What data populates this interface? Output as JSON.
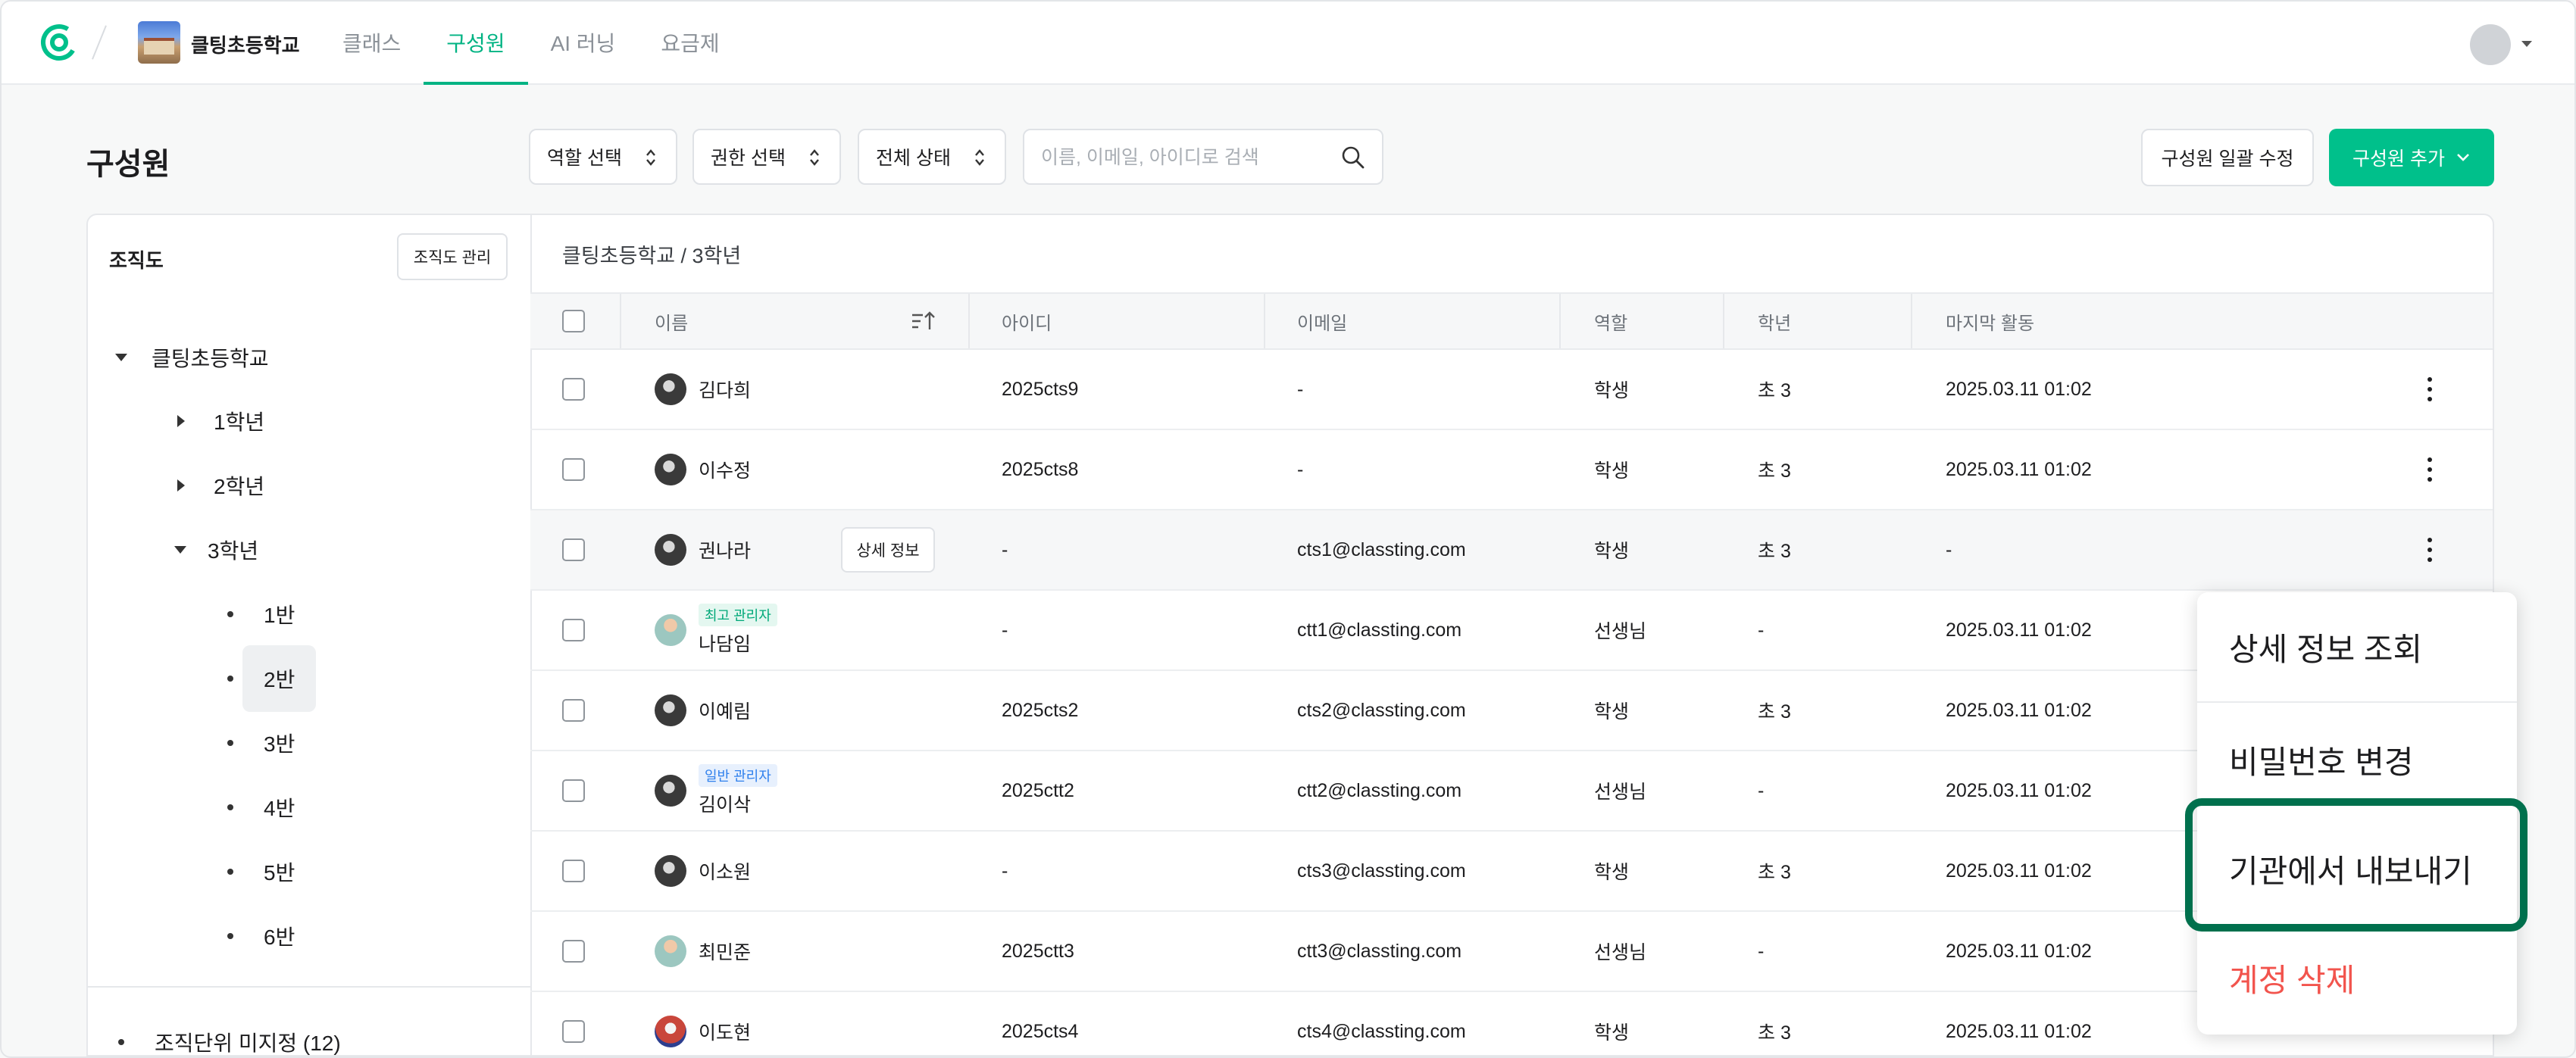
{
  "header": {
    "school_name": "클팅초등학교",
    "nav": [
      "클래스",
      "구성원",
      "AI 러닝",
      "요금제"
    ],
    "active_nav": "구성원"
  },
  "toolbar": {
    "title": "구성원",
    "role_select": "역할 선택",
    "permission_select": "권한 선택",
    "status_select": "전체 상태",
    "search_placeholder": "이름, 이메일, 아이디로 검색",
    "bulk_edit_label": "구성원 일괄 수정",
    "add_member_label": "구성원 추가"
  },
  "org": {
    "title": "조직도",
    "manage_label": "조직도 관리",
    "root": "클팅초등학교",
    "grade1": "1학년",
    "grade2": "2학년",
    "grade3": "3학년",
    "classes": [
      "1반",
      "2반",
      "3반",
      "4반",
      "5반",
      "6반"
    ],
    "selected_class": "2반",
    "unassigned": "조직단위 미지정 (12)"
  },
  "table": {
    "breadcrumb": "클팅초등학교 / 3학년",
    "columns": {
      "name": "이름",
      "id": "아이디",
      "email": "이메일",
      "role": "역할",
      "grade": "학년",
      "last_active": "마지막 활동"
    },
    "detail_button": "상세 정보",
    "rows": [
      {
        "name": "김다희",
        "badge": "",
        "id": "2025cts9",
        "email": "-",
        "role": "학생",
        "grade": "초 3",
        "last": "2025.03.11 01:02"
      },
      {
        "name": "이수정",
        "badge": "",
        "id": "2025cts8",
        "email": "-",
        "role": "학생",
        "grade": "초 3",
        "last": "2025.03.11 01:02"
      },
      {
        "name": "권나라",
        "badge": "",
        "id": "-",
        "email": "cts1@classting.com",
        "role": "학생",
        "grade": "초 3",
        "last": "-"
      },
      {
        "name": "나담임",
        "badge": "최고 관리자",
        "id": "-",
        "email": "ctt1@classting.com",
        "role": "선생님",
        "grade": "-",
        "last": "2025.03.11 01:02"
      },
      {
        "name": "이예림",
        "badge": "",
        "id": "2025cts2",
        "email": "cts2@classting.com",
        "role": "학생",
        "grade": "초 3",
        "last": "2025.03.11 01:02"
      },
      {
        "name": "김이삭",
        "badge": "일반 관리자",
        "id": "2025ctt2",
        "email": "ctt2@classting.com",
        "role": "선생님",
        "grade": "-",
        "last": "2025.03.11 01:02"
      },
      {
        "name": "이소원",
        "badge": "",
        "id": "-",
        "email": "cts3@classting.com",
        "role": "학생",
        "grade": "초 3",
        "last": "2025.03.11 01:02"
      },
      {
        "name": "최민준",
        "badge": "",
        "id": "2025ctt3",
        "email": "ctt3@classting.com",
        "role": "선생님",
        "grade": "-",
        "last": "2025.03.11 01:02"
      },
      {
        "name": "이도현",
        "badge": "",
        "id": "2025cts4",
        "email": "cts4@classting.com",
        "role": "학생",
        "grade": "초 3",
        "last": "2025.03.11 01:02"
      }
    ]
  },
  "context_menu": {
    "items": [
      "상세 정보 조회",
      "비밀번호 변경",
      "기관에서 내보내기",
      "계정 삭제"
    ]
  },
  "colors": {
    "brand": "#00c08b",
    "danger": "#f2544d",
    "highlight": "#00704d"
  }
}
